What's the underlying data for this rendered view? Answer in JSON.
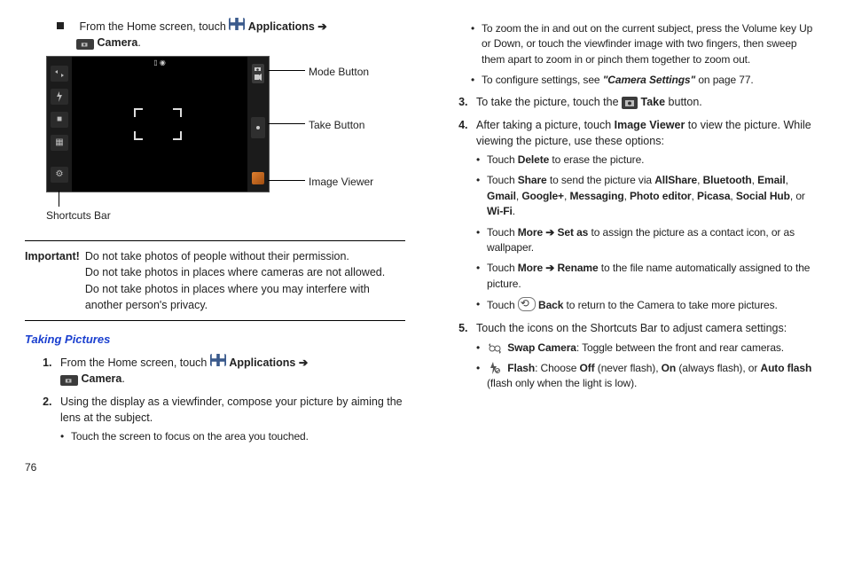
{
  "pageNumber": "76",
  "left": {
    "openInstruction": {
      "prefixText": "From the Home screen, touch ",
      "applications": "Applications",
      "arrow": "➔",
      "camera": "Camera",
      "period": "."
    },
    "figure": {
      "labels": {
        "modeButton": "Mode Button",
        "takeButton": "Take Button",
        "imageViewer": "Image Viewer",
        "shortcutsBar": "Shortcuts Bar"
      }
    },
    "important": {
      "label": "Important!",
      "body1": "Do not take photos of people without their permission.",
      "body2": "Do not take photos in places where cameras are not allowed.",
      "body3": "Do not take photos in places where you may interfere with another person's privacy."
    },
    "sectionTitle": "Taking Pictures",
    "steps": {
      "s1": {
        "prefixText": "From the Home screen, touch ",
        "applications": "Applications",
        "arrow": "➔",
        "camera": "Camera",
        "period": "."
      },
      "s2": {
        "text": "Using the display as a viewfinder, compose your picture by aiming the lens at the subject.",
        "bullet1": "Touch the screen to focus on the area you touched."
      }
    }
  },
  "right": {
    "s2_bullets": {
      "zoom": "To zoom the in and out on the current subject, press the Volume key Up or Down, or touch the viewfinder image with two fingers, then sweep them apart to zoom in or pinch them together to zoom out.",
      "configurePrefix": "To configure settings, see ",
      "cameraSettings": "\"Camera Settings\"",
      "configureSuffix": " on page 77."
    },
    "s3": {
      "prefix": "To take the picture, touch the ",
      "take": "Take",
      "suffix": " button."
    },
    "s4": {
      "line1a": "After taking a picture, touch ",
      "imageViewer": "Image Viewer",
      "line1b": " to view the picture. While viewing the picture, use these options:",
      "bullets": {
        "delete": {
          "pre": "Touch ",
          "bold": "Delete",
          "post": " to erase the picture."
        },
        "share": {
          "pre": "Touch ",
          "share": "Share",
          "mid": " to send the picture via ",
          "allshare": "AllShare",
          "c1": ", ",
          "bluetooth": "Bluetooth",
          "c2": ", ",
          "email": "Email",
          "c3": ", ",
          "gmail": "Gmail",
          "c4": ", ",
          "google": "Google+",
          "c5": ", ",
          "messaging": "Messaging",
          "c6": ", ",
          "photoeditor": "Photo editor",
          "c7": ", ",
          "picasa": "Picasa",
          "c8": ", ",
          "socialhub": "Social Hub",
          "c9": ", or ",
          "wifi": "Wi-Fi",
          "period": "."
        },
        "setas": {
          "pre": "Touch ",
          "more": "More",
          "arrow": " ➔ ",
          "setas": "Set as",
          "post": " to assign the picture as a contact icon, or as wallpaper."
        },
        "rename": {
          "pre": "Touch ",
          "more": "More",
          "arrow": " ➔ ",
          "rename": "Rename",
          "post": " to the file name automatically assigned to the picture."
        },
        "back": {
          "pre": "Touch ",
          "back": "Back",
          "post": " to return to the Camera to take more pictures."
        }
      }
    },
    "s5": {
      "text": "Touch the icons on the Shortcuts Bar to adjust camera settings:",
      "bullets": {
        "swap": {
          "bold": "Swap Camera",
          "post": ": Toggle between the front and rear cameras."
        },
        "flash": {
          "bold": "Flash",
          "mid": ": Choose ",
          "off": "Off",
          "p1": " (never flash), ",
          "on": "On",
          "p2": " (always flash), or ",
          "auto": "Auto flash",
          "p3": "  (flash only when the light is low)."
        }
      }
    }
  }
}
